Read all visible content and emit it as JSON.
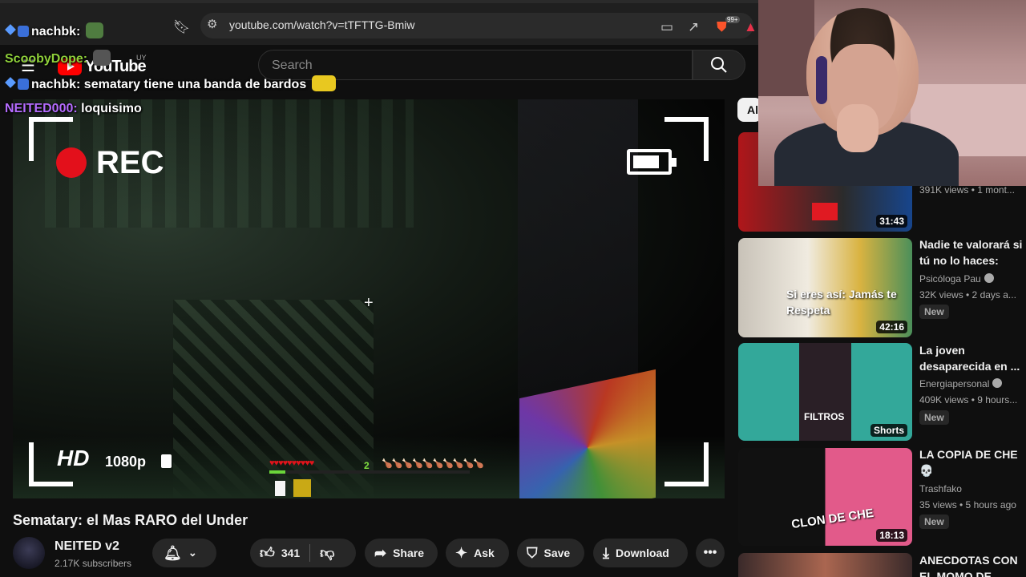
{
  "browser": {
    "url": "youtube.com/watch?v=tTFTTG-Bmiw",
    "brave_badge": "99+"
  },
  "youtube": {
    "logo_text": "YouTube",
    "country_code": "UY",
    "search_placeholder": "Search"
  },
  "chat": [
    {
      "user": "nachbk:",
      "user_color": "#ffffff",
      "message": ""
    },
    {
      "user": "ScoobyDope:",
      "user_color": "#8ecf3a",
      "message": ""
    },
    {
      "user": "nachbk:",
      "user_color": "#ffffff",
      "message": "sematary tiene una banda de bardos"
    },
    {
      "user": "NEITED000:",
      "user_color": "#b56cff",
      "message": "loquisimo"
    }
  ],
  "video_overlay": {
    "rec_label": "REC",
    "hd_label": "HD",
    "resolution": "1080p",
    "battery_level": 0.8,
    "xp_level": "2",
    "hearts": "♥♥♥♥♥♥♥♥♥♥",
    "food": "🍗🍗🍗🍗🍗🍗🍗🍗🍗🍗",
    "xp_fill": 0.08
  },
  "video": {
    "title": "Sematary: el Mas RARO del Under",
    "channel": "NEITED v2",
    "subscribers": "2.17K subscribers",
    "likes": "341",
    "share_label": "Share",
    "ask_label": "Ask",
    "save_label": "Save",
    "download_label": "Download"
  },
  "sidebar": {
    "chip": "Al",
    "items": [
      {
        "title": "",
        "channel": "",
        "meta": "391K views • 1 mont...",
        "duration": "31:43",
        "new": ""
      },
      {
        "title": "Nadie te valorará si tú no lo haces: La...",
        "channel": "Psicóloga Pau",
        "meta": "32K views • 2 days a...",
        "duration": "42:16",
        "new": "New",
        "thumb_text": "Si eres así: Jamás te Respeta"
      },
      {
        "title": "La joven desaparecida en ...",
        "channel": "Energiapersonal",
        "meta": "409K views • 9 hours...",
        "duration": "Shorts",
        "new": "New",
        "thumb_text": "FILTROS"
      },
      {
        "title": "LA COPIA DE CHE 💀",
        "channel": "Trashfako",
        "meta": "35 views • 5 hours ago",
        "duration": "18:13",
        "new": "New",
        "thumb_text": "CLON DE CHE"
      },
      {
        "title": "ANECDOTAS CON EL MOMO DE...",
        "channel": "",
        "meta": "",
        "duration": "",
        "new": ""
      }
    ]
  }
}
